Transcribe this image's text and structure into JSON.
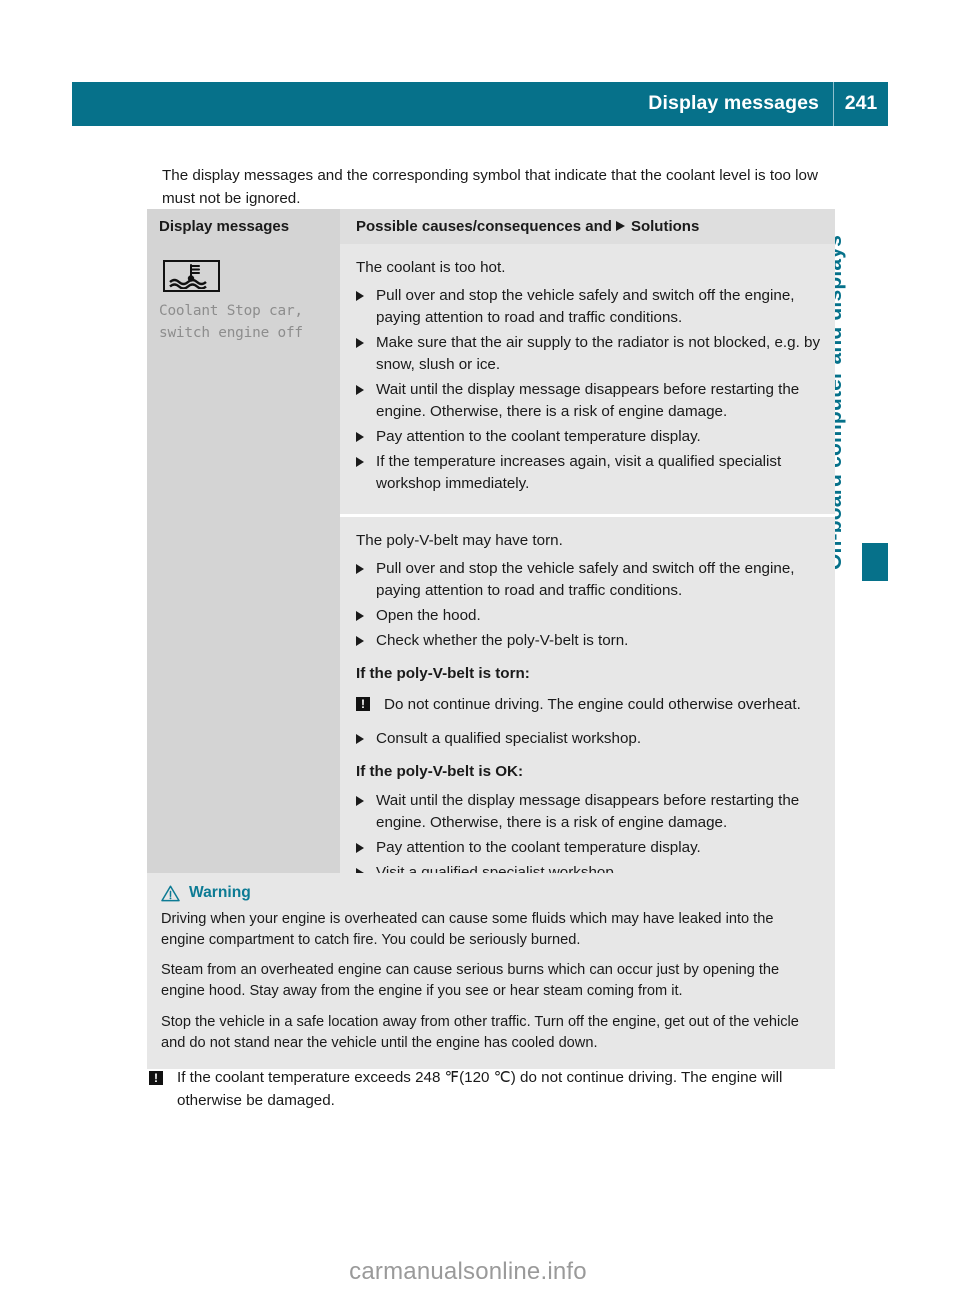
{
  "header": {
    "title": "Display messages",
    "page_number": "241",
    "accent_color": "#06718a"
  },
  "side_tab": {
    "label": "On-board computer and displays",
    "color": "#06718a"
  },
  "intro": "The display messages and the corresponding symbol that indicate that the coolant level is too low must not be ignored.",
  "table": {
    "headers": {
      "left": "Display messages",
      "right_before": "Possible causes/consequences and",
      "right_after": "Solutions"
    },
    "message": {
      "symbol_name": "coolant-temperature-warning-symbol",
      "text": "Coolant Stop car,\nswitch engine off"
    },
    "blocks": [
      {
        "lead": "The coolant is too hot.",
        "items": [
          {
            "type": "step",
            "text": "Pull over and stop the vehicle safely and switch off the engine, paying attention to road and traffic conditions."
          },
          {
            "type": "step",
            "text": "Make sure that the air supply to the radiator is not blocked, e.g. by snow, slush or ice."
          },
          {
            "type": "step",
            "text": "Wait until the display message disappears before restarting the engine. Otherwise, there is a risk of engine damage."
          },
          {
            "type": "step",
            "text": "Pay attention to the coolant temperature display."
          },
          {
            "type": "step",
            "text": "If the temperature increases again, visit a qualified specialist workshop immediately."
          }
        ]
      },
      {
        "lead": "The poly-V-belt may have torn.",
        "items": [
          {
            "type": "step",
            "text": "Pull over and stop the vehicle safely and switch off the engine, paying attention to road and traffic conditions."
          },
          {
            "type": "step",
            "text": "Open the hood."
          },
          {
            "type": "step",
            "text": "Check whether the poly-V-belt is torn."
          },
          {
            "type": "subhead",
            "text": "If the poly-V-belt is torn:"
          },
          {
            "type": "note",
            "text": "Do not continue driving. The engine could otherwise overheat."
          },
          {
            "type": "step",
            "text": "Consult a qualified specialist workshop."
          },
          {
            "type": "subhead",
            "text": "If the poly-V-belt is OK:"
          },
          {
            "type": "step",
            "text": "Wait until the display message disappears before restarting the engine. Otherwise, there is a risk of engine damage."
          },
          {
            "type": "step",
            "text": "Pay attention to the coolant temperature display."
          },
          {
            "type": "step",
            "text": "Visit a qualified specialist workshop."
          }
        ]
      }
    ]
  },
  "warning": {
    "title": "Warning",
    "title_color": "#0d7b94",
    "paragraphs": [
      "Driving when your engine is overheated can cause some fluids which may have leaked into the engine compartment to catch fire. You could be seriously burned.",
      "Steam from an overheated engine can cause serious burns which can occur just by opening the engine hood. Stay away from the engine if you see or hear steam coming from it.",
      "Stop the vehicle in a safe location away from other traffic. Turn off the engine, get out of the vehicle and do not stand near the vehicle until the engine has cooled down."
    ]
  },
  "bottom_note": "If the coolant temperature exceeds 248 ℉(120 ℃) do not continue driving. The engine will otherwise be damaged.",
  "watermark": "carmanualsonline.info"
}
